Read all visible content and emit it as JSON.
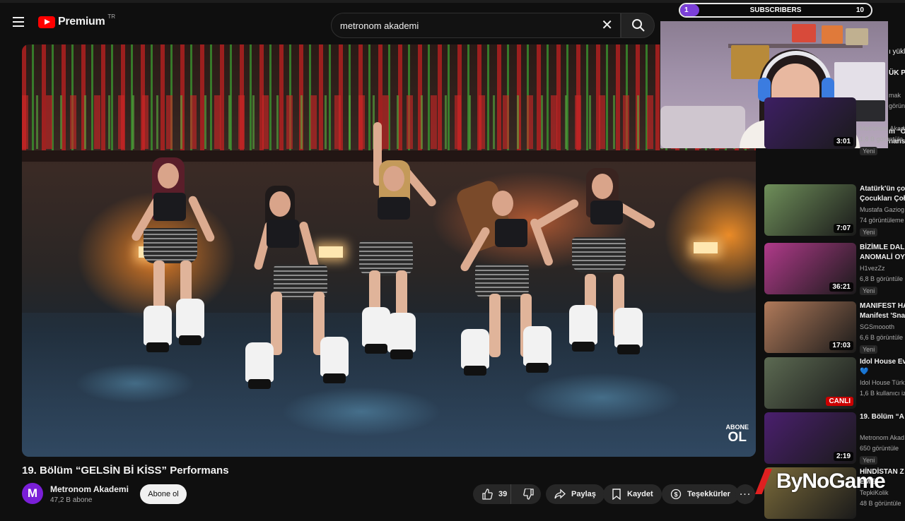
{
  "header": {
    "logo_text": "Premium",
    "region": "TR",
    "search_value": "metronom akademi"
  },
  "video": {
    "overlay_small": "ABONE",
    "overlay_big": "OL",
    "title": "19. Bölüm “GELSİN Bİ KİSS” Performans"
  },
  "channel": {
    "avatar_letter": "M",
    "name": "Metronom Akademi",
    "subscribers": "47,2 B abone",
    "subscribe_label": "Abone ol"
  },
  "actions": {
    "likes": "39",
    "share": "Paylaş",
    "save": "Kaydet",
    "thanks": "Teşekkürler",
    "more": "..."
  },
  "sub_widget": {
    "start": "1",
    "label": "SUBSCRIBERS",
    "goal": "10",
    "progress_fraction": 0.1
  },
  "peek": {
    "p1": "ı yükl",
    "p2": "ÜK PU",
    "p3": "mak",
    "p4": "görüntü",
    "p5": "m “Ö",
    "p6": "nans"
  },
  "sidebar": {
    "items": [
      {
        "title1": "",
        "title2": "",
        "channel": "Metronom Akad",
        "views": "1,8 B görüntüle",
        "badge": "Yeni",
        "duration": "3:01",
        "thumb_color": "#3d1f63"
      },
      {
        "title1": "Atatürk'ün ço",
        "title2": "Çocukları Çoł",
        "channel": "Mustafa Gaziog",
        "views": "74 görüntüleme",
        "badge": "Yeni",
        "duration": "7:07",
        "thumb_color": "#6f8f5a"
      },
      {
        "title1": "BİZİMLE DAL",
        "title2": "ANOMALİ OY",
        "channel": "H1vezZz",
        "views": "6,8 B görüntüle",
        "badge": "Yeni",
        "duration": "36:21",
        "thumb_color": "#b03a8a"
      },
      {
        "title1": "MANIFEST HA",
        "title2": "Manifest 'Sna",
        "channel": "SGSmoooth",
        "views": "6,6 B görüntüle",
        "badge": "Yeni",
        "duration": "17:03",
        "thumb_color": "#b07a5a"
      },
      {
        "title1": "Idol House Ev",
        "title2": "💙",
        "channel": "Idol House Türk",
        "views": "1,6 B kullanıcı iz",
        "badge": "",
        "duration": "CANLI",
        "thumb_color": "#5c6a52"
      },
      {
        "title1": "19. Bölüm “A",
        "title2": "",
        "channel": "Metronom Akad",
        "views": "650 görüntüle",
        "badge": "Yeni",
        "duration": "2:19",
        "thumb_color": "#4a1f6e"
      },
      {
        "title1": "HİNDİSTAN Z",
        "title2": "EME",
        "channel": "TepkiKolik",
        "views": "48 B görüntüle",
        "badge": "",
        "duration": "",
        "thumb_color": "#7a6a3a"
      }
    ]
  },
  "watermark": {
    "text": "ByNoGame"
  }
}
